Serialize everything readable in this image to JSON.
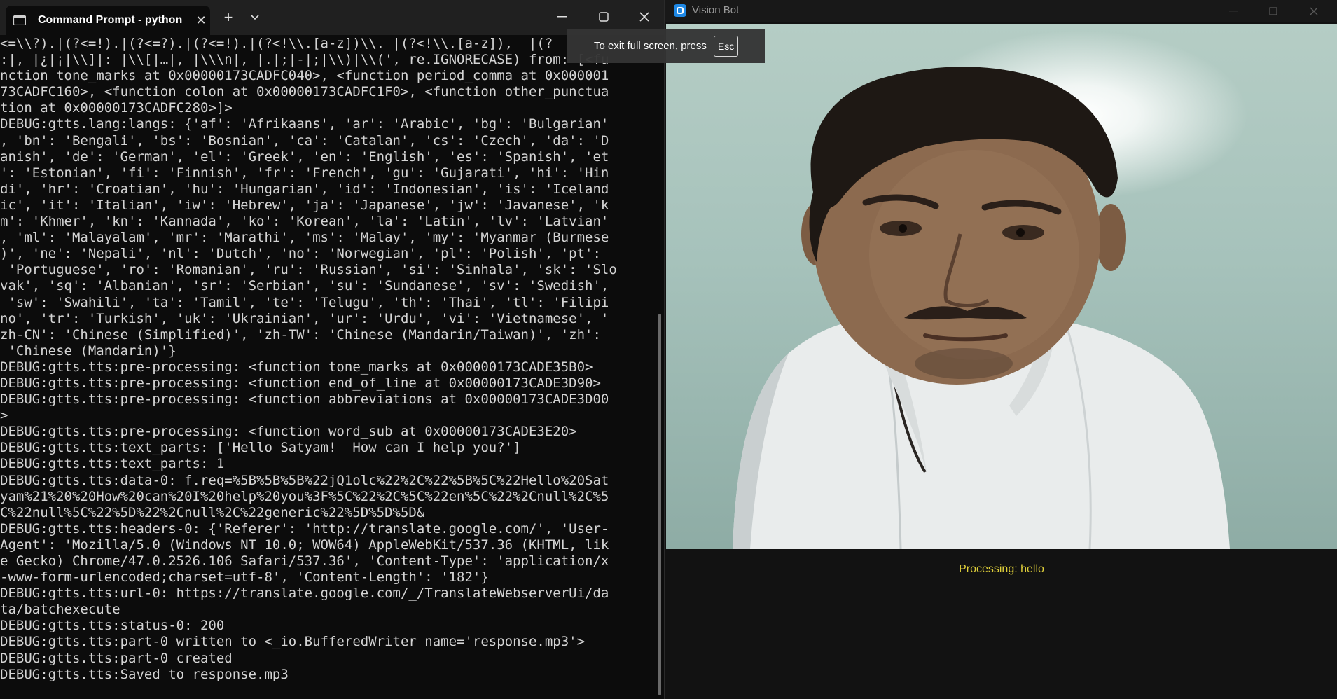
{
  "terminal": {
    "tab_title": "Command Prompt - python  ,",
    "tab_icon": "terminal-icon",
    "new_tab_label": "+",
    "close_tab_label": "✕",
    "lines": [
      "<=\\\\?).|(?<=!).|(?<=?).|(?<=!).|(?<!\\\\.[a-z])\\\\. |(?<!\\\\.[a-z]),  |(?",
      ":|, |¿|¡|\\\\]|: |\\\\[|…|, |\\\\\\n|, |.|;|-|;|\\\\)|\\\\(', re.IGNORECASE) from: [<fu",
      "nction tone_marks at 0x00000173CADFC040>, <function period_comma at 0x000001",
      "73CADFC160>, <function colon at 0x00000173CADFC1F0>, <function other_punctua",
      "tion at 0x00000173CADFC280>]>",
      "DEBUG:gtts.lang:langs: {'af': 'Afrikaans', 'ar': 'Arabic', 'bg': 'Bulgarian'",
      ", 'bn': 'Bengali', 'bs': 'Bosnian', 'ca': 'Catalan', 'cs': 'Czech', 'da': 'D",
      "anish', 'de': 'German', 'el': 'Greek', 'en': 'English', 'es': 'Spanish', 'et",
      "': 'Estonian', 'fi': 'Finnish', 'fr': 'French', 'gu': 'Gujarati', 'hi': 'Hin",
      "di', 'hr': 'Croatian', 'hu': 'Hungarian', 'id': 'Indonesian', 'is': 'Iceland",
      "ic', 'it': 'Italian', 'iw': 'Hebrew', 'ja': 'Japanese', 'jw': 'Javanese', 'k",
      "m': 'Khmer', 'kn': 'Kannada', 'ko': 'Korean', 'la': 'Latin', 'lv': 'Latvian'",
      ", 'ml': 'Malayalam', 'mr': 'Marathi', 'ms': 'Malay', 'my': 'Myanmar (Burmese",
      ")', 'ne': 'Nepali', 'nl': 'Dutch', 'no': 'Norwegian', 'pl': 'Polish', 'pt':",
      " 'Portuguese', 'ro': 'Romanian', 'ru': 'Russian', 'si': 'Sinhala', 'sk': 'Slo",
      "vak', 'sq': 'Albanian', 'sr': 'Serbian', 'su': 'Sundanese', 'sv': 'Swedish',",
      " 'sw': 'Swahili', 'ta': 'Tamil', 'te': 'Telugu', 'th': 'Thai', 'tl': 'Filipi",
      "no', 'tr': 'Turkish', 'uk': 'Ukrainian', 'ur': 'Urdu', 'vi': 'Vietnamese', '",
      "zh-CN': 'Chinese (Simplified)', 'zh-TW': 'Chinese (Mandarin/Taiwan)', 'zh':",
      " 'Chinese (Mandarin)'}",
      "DEBUG:gtts.tts:pre-processing: <function tone_marks at 0x00000173CADE35B0>",
      "DEBUG:gtts.tts:pre-processing: <function end_of_line at 0x00000173CADE3D90>",
      "DEBUG:gtts.tts:pre-processing: <function abbreviations at 0x00000173CADE3D00",
      ">",
      "DEBUG:gtts.tts:pre-processing: <function word_sub at 0x00000173CADE3E20>",
      "DEBUG:gtts.tts:text_parts: ['Hello Satyam!  How can I help you?']",
      "DEBUG:gtts.tts:text_parts: 1",
      "DEBUG:gtts.tts:data-0: f.req=%5B%5B%5B%22jQ1olc%22%2C%22%5B%5C%22Hello%20Sat",
      "yam%21%20%20How%20can%20I%20help%20you%3F%5C%22%2C%5C%22en%5C%22%2Cnull%2C%5",
      "C%22null%5C%22%5D%22%2Cnull%2C%22generic%22%5D%5D%5D&",
      "DEBUG:gtts.tts:headers-0: {'Referer': 'http://translate.google.com/', 'User-",
      "Agent': 'Mozilla/5.0 (Windows NT 10.0; WOW64) AppleWebKit/537.36 (KHTML, lik",
      "e Gecko) Chrome/47.0.2526.106 Safari/537.36', 'Content-Type': 'application/x",
      "-www-form-urlencoded;charset=utf-8', 'Content-Length': '182'}",
      "DEBUG:gtts.tts:url-0: https://translate.google.com/_/TranslateWebserverUi/da",
      "ta/batchexecute",
      "DEBUG:gtts.tts:status-0: 200",
      "DEBUG:gtts.tts:part-0 written to <_io.BufferedWriter name='response.mp3'>",
      "DEBUG:gtts.tts:part-0 created",
      "DEBUG:gtts.tts:Saved to response.mp3"
    ]
  },
  "visionbot": {
    "title": "Vision Bot",
    "status": "Processing: hello",
    "status_color": "#e0d03a"
  },
  "fullscreen_toast": {
    "message": "To exit full screen, press",
    "key": "Esc"
  },
  "colors": {
    "terminal_bg": "#0c0c0c",
    "terminal_text": "#d4d4d4",
    "titlebar": "#202020",
    "vision_bot_icon": "#1e88e5"
  }
}
